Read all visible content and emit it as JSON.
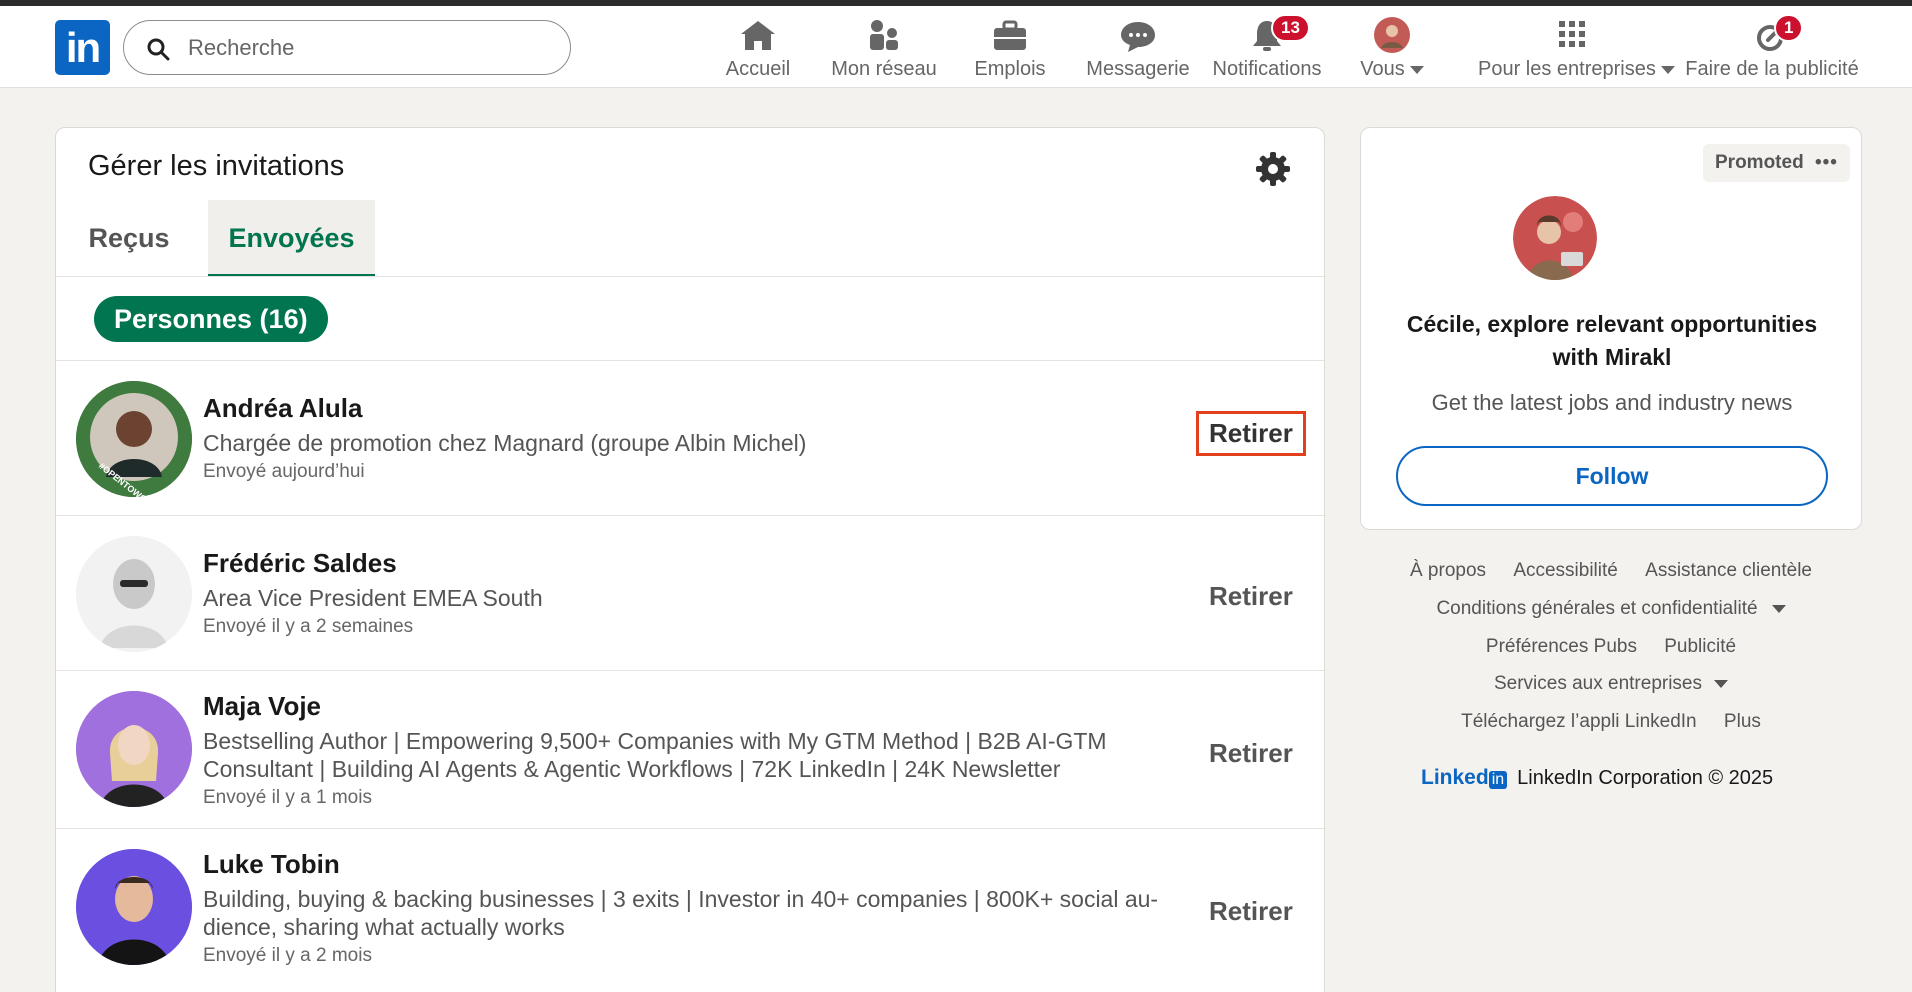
{
  "search": {
    "placeholder": "Recherche"
  },
  "nav": {
    "home": "Accueil",
    "network": "Mon réseau",
    "jobs": "Emplois",
    "messaging": "Messagerie",
    "notifications": "Notifications",
    "notifications_count": "13",
    "me": "Vous",
    "business": "Pour les entreprises",
    "advertise": "Faire de la publicité",
    "advertise_count": "1"
  },
  "invitations": {
    "title": "Gérer les invitations",
    "tabs": [
      "Reçus",
      "Envoyées"
    ],
    "active_tab": "Envoyées",
    "filter_pill": "Personnes (16)",
    "people": [
      {
        "name": "Andréa Alula",
        "headline": "Chargée de promotion chez Magnard (groupe Albin Michel)",
        "sent": "Envoyé aujourd’hui",
        "action": "Retirer",
        "avatar_badge": "#OPENTOWORK"
      },
      {
        "name": "Frédéric Saldes",
        "headline": "Area Vice President EMEA South",
        "sent": "Envoyé il y a 2 semaines",
        "action": "Retirer"
      },
      {
        "name": "Maja Voje",
        "headline": "Bestselling Author | Empowering 9,500+ Companies with My GTM Method | B2B AI-GTM Consultant | Building AI Agents & Agentic Workflows | 72K LinkedIn | 24K Newsletter",
        "sent": "Envoyé il y a 1 mois",
        "action": "Retirer"
      },
      {
        "name": "Luke Tobin",
        "headline": "Building, buying & backing businesses | 3 exits | Investor in 40+ companies | 800K+ social au-dience, sharing what actually works",
        "sent": "Envoyé il y a 2 mois",
        "action": "Retirer"
      }
    ]
  },
  "ad": {
    "promoted": "Promoted",
    "title": "Cécile, explore relevant opportunities with Mirakl",
    "subtitle": "Get the latest jobs and industry news",
    "follow": "Follow"
  },
  "footer": {
    "about": "À propos",
    "accessibility": "Accessibilité",
    "help": "Assistance clientèle",
    "privacy": "Conditions générales et confidentialité",
    "ad_prefs": "Préférences Pubs",
    "advertising": "Publicité",
    "business_services": "Services aux entreprises",
    "get_app": "Téléchargez l’appli LinkedIn",
    "more": "Plus",
    "brand_word": "Linked",
    "brand_box": "in",
    "copyright": "LinkedIn Corporation © 2025"
  },
  "colors": {
    "brand_blue": "#0a66c2",
    "green_accent": "#01754f",
    "badge_red": "#cb112d",
    "highlight_red": "#e2401c"
  }
}
